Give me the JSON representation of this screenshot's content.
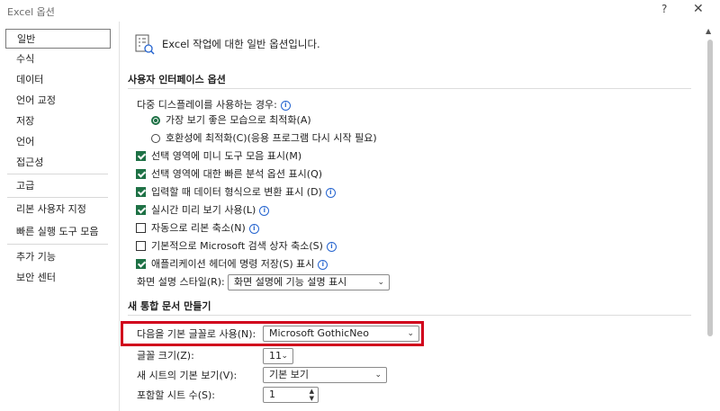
{
  "window": {
    "title": "Excel 옵션",
    "help_label": "?",
    "close_label": "✕"
  },
  "sidebar": {
    "items": [
      {
        "label": "일반"
      },
      {
        "label": "수식"
      },
      {
        "label": "데이터"
      },
      {
        "label": "언어 교정"
      },
      {
        "label": "저장"
      },
      {
        "label": "언어"
      },
      {
        "label": "접근성"
      },
      {
        "label": "고급"
      },
      {
        "label": "리본 사용자 지정"
      },
      {
        "label": "빠른 실행 도구 모음"
      },
      {
        "label": "추가 기능"
      },
      {
        "label": "보안 센터"
      }
    ]
  },
  "header": {
    "text": "Excel 작업에 대한 일반 옵션입니다."
  },
  "ui_options": {
    "section_title": "사용자 인터페이스 옵션",
    "multi_display_label": "다중 디스플레이를 사용하는 경우:",
    "radio_best": "가장 보기 좋은 모습으로 최적화(A)",
    "radio_compat": "호환성에 최적화(C)(응용 프로그램 다시 시작 필요)",
    "cb_mini_toolbar": "선택 영역에 미니 도구 모음 표시(M)",
    "cb_quick_analysis": "선택 영역에 대한 빠른 분석 옵션 표시(Q)",
    "cb_data_convert": "입력할 때 데이터 형식으로 변환 표시 (D)",
    "cb_live_preview": "실시간 미리 보기 사용(L)",
    "cb_collapse_ribbon": "자동으로 리본 축소(N)",
    "cb_collapse_search": "기본적으로 Microsoft 검색 상자 축소(S)",
    "cb_show_commands": "애플리케이션 헤더에 명령 저장(S) 표시",
    "tooltip_style_label": "화면 설명 스타일(R):",
    "tooltip_style_value": "화면 설명에 기능 설명 표시"
  },
  "new_workbook": {
    "section_title": "새 통합 문서 만들기",
    "font_label": "다음을 기본 글꼴로 사용(N):",
    "font_value": "Microsoft GothicNeo",
    "size_label": "글꼴 크기(Z):",
    "size_value": "11",
    "view_label": "새 시트의 기본 보기(V):",
    "view_value": "기본 보기",
    "sheets_label": "포함할 시트 수(S):",
    "sheets_value": "1"
  },
  "colors": {
    "accent": "#1e7145",
    "highlight": "#d1001c",
    "info": "#2564cf"
  }
}
